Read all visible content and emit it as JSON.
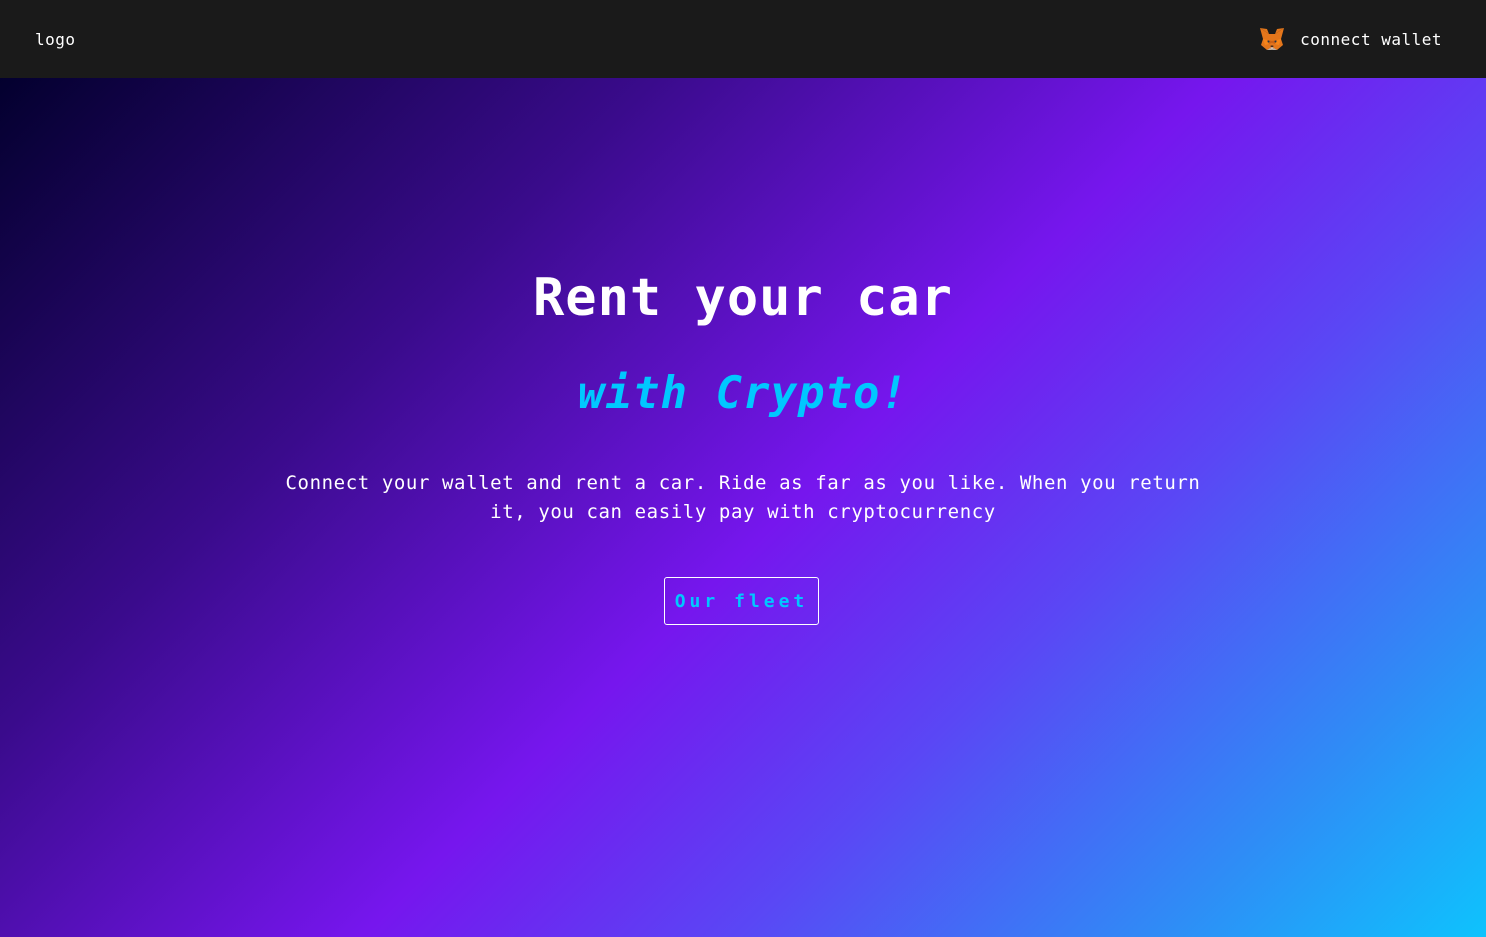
{
  "navbar": {
    "logo_text": "logo",
    "connect_label": "connect wallet",
    "connect_icon": "metamask-fox-icon"
  },
  "hero": {
    "title": "Rent your car",
    "subtitle": "with Crypto!",
    "description": "Connect your wallet and rent a car. Ride as far as you like. When you return it, you can easily pay with cryptocurrency",
    "button_label": "Our fleet"
  },
  "colors": {
    "navbar_bg": "#1a1a1a",
    "accent_cyan": "#00c8ff",
    "gradient_start": "#03002e",
    "gradient_mid": "#7616ee",
    "gradient_end": "#0ec3fd"
  }
}
